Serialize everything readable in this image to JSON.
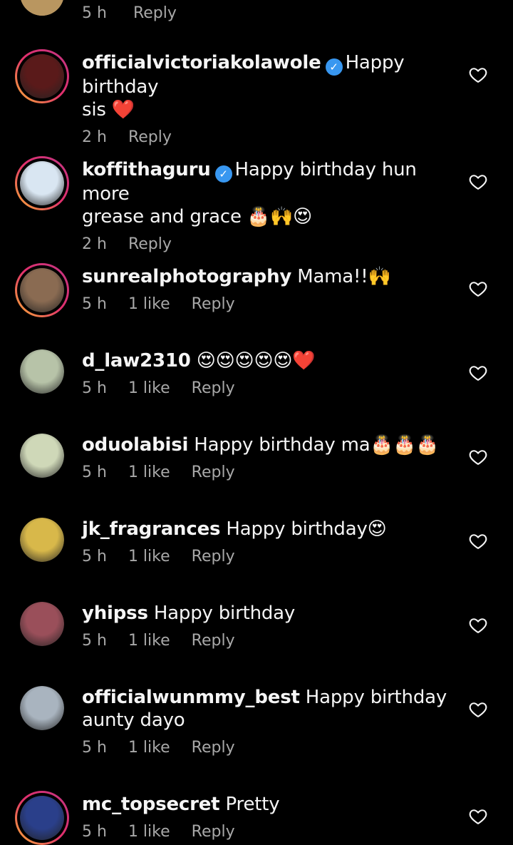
{
  "top_partial": {
    "time": "5 h",
    "reply": "Reply"
  },
  "comments": [
    {
      "username": "officialvictoriakolawole",
      "verified": true,
      "text_line1": "Happy birthday",
      "text_line2": "sis ❤️",
      "time": "2 h",
      "likes": "",
      "reply": "Reply",
      "avatar_color": "#5a1a1a",
      "story": true
    },
    {
      "username": "koffithaguru",
      "verified": true,
      "text_line1": "Happy birthday hun more",
      "text_line2": "grease and grace 🎂🙌😍",
      "time": "2 h",
      "likes": "",
      "reply": "Reply",
      "avatar_color": "#d9e6f2",
      "story": true
    },
    {
      "username": "sunrealphotography",
      "verified": false,
      "text_line1": "Mama!!🙌",
      "text_line2": "",
      "time": "5 h",
      "likes": "1 like",
      "reply": "Reply",
      "avatar_color": "#8a6b52",
      "story": true
    },
    {
      "username": "d_law2310",
      "verified": false,
      "text_line1": "😍😍😍😍😍❤️",
      "text_line2": "",
      "time": "5 h",
      "likes": "1 like",
      "reply": "Reply",
      "avatar_color": "#b7c3a8",
      "story": false
    },
    {
      "username": "oduolabisi",
      "verified": false,
      "text_line1": "Happy birthday ma🎂🎂🎂",
      "text_line2": "",
      "time": "5 h",
      "likes": "1 like",
      "reply": "Reply",
      "avatar_color": "#cfd8b8",
      "story": false
    },
    {
      "username": "jk_fragrances",
      "verified": false,
      "text_line1": "Happy birthday😍",
      "text_line2": "",
      "time": "5 h",
      "likes": "1 like",
      "reply": "Reply",
      "avatar_color": "#d8b84a",
      "story": false
    },
    {
      "username": "yhipss",
      "verified": false,
      "text_line1": "Happy birthday",
      "text_line2": "",
      "time": "5 h",
      "likes": "1 like",
      "reply": "Reply",
      "avatar_color": "#9a4f5a",
      "story": false
    },
    {
      "username": "officialwunmmy_best",
      "verified": false,
      "text_line1": "Happy birthday",
      "text_line2": "aunty dayo",
      "time": "5 h",
      "likes": "1 like",
      "reply": "Reply",
      "avatar_color": "#a9b4bf",
      "story": false
    },
    {
      "username": "mc_topsecret",
      "verified": false,
      "text_line1": "Pretty",
      "text_line2": "",
      "time": "5 h",
      "likes": "1 like",
      "reply": "Reply",
      "avatar_color": "#2a3f8a",
      "story": true
    }
  ]
}
